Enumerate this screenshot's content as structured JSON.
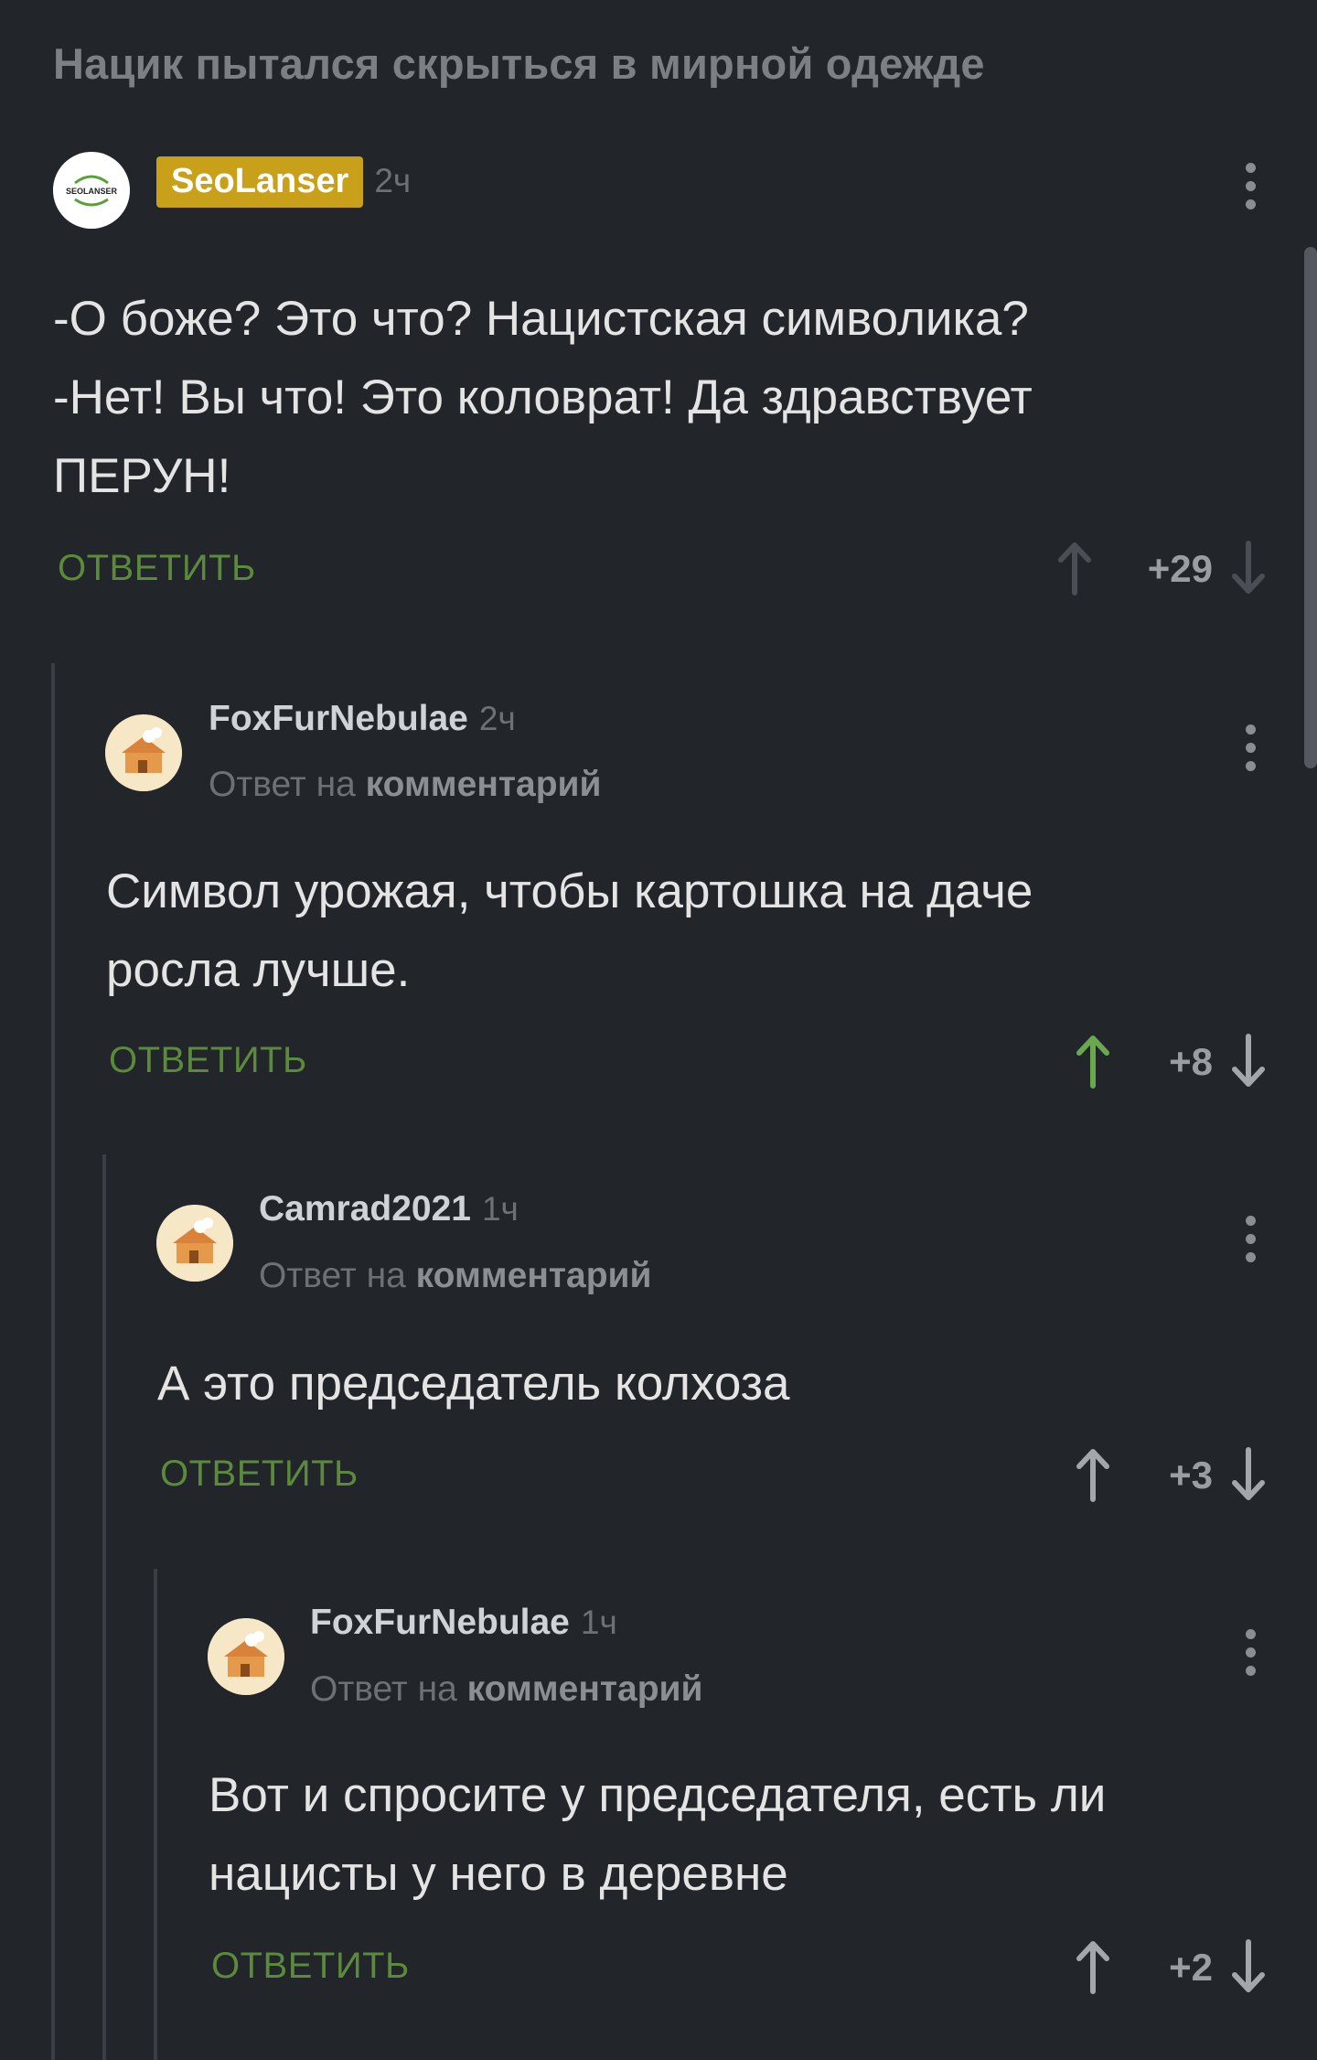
{
  "post": {
    "title": "Нацик пытался скрыться в мирной одежде"
  },
  "labels": {
    "reply_button": "ОТВЕТИТЬ",
    "reply_to_prefix": "Ответ на ",
    "reply_to_link": "комментарий"
  },
  "avatars": {
    "seolanser_text": "SEOLANSER"
  },
  "comments": [
    {
      "author": "SeoLanser",
      "time": "2ч",
      "text_lines": [
        "-О боже? Это что? Нацистская символика?",
        "-Нет! Вы что! Это коловрат! Да здравствует",
        "ПЕРУН!"
      ],
      "score": "+29",
      "voted": "none"
    },
    {
      "author": "FoxFurNebulae",
      "time": "2ч",
      "text_lines": [
        "Символ урожая, чтобы картошка на даче",
        "росла лучше."
      ],
      "score": "+8",
      "voted": "up"
    },
    {
      "author": "Camrad2021",
      "time": "1ч",
      "text_lines": [
        "А это председатель колхоза"
      ],
      "score": "+3",
      "voted": "none"
    },
    {
      "author": "FoxFurNebulae",
      "time": "1ч",
      "text_lines": [
        "Вот и спросите у председателя, есть ли",
        "нацисты у него в деревне"
      ],
      "score": "+2",
      "voted": "none"
    }
  ],
  "colors": {
    "background": "#22252a",
    "reply_green": "#5b8a3c",
    "upvote_active": "#6aa84f",
    "badge_gold": "#c9a01a"
  },
  "icons": {
    "upvote": "arrow-up-icon",
    "downvote": "arrow-down-icon",
    "menu": "more-vertical-icon"
  }
}
